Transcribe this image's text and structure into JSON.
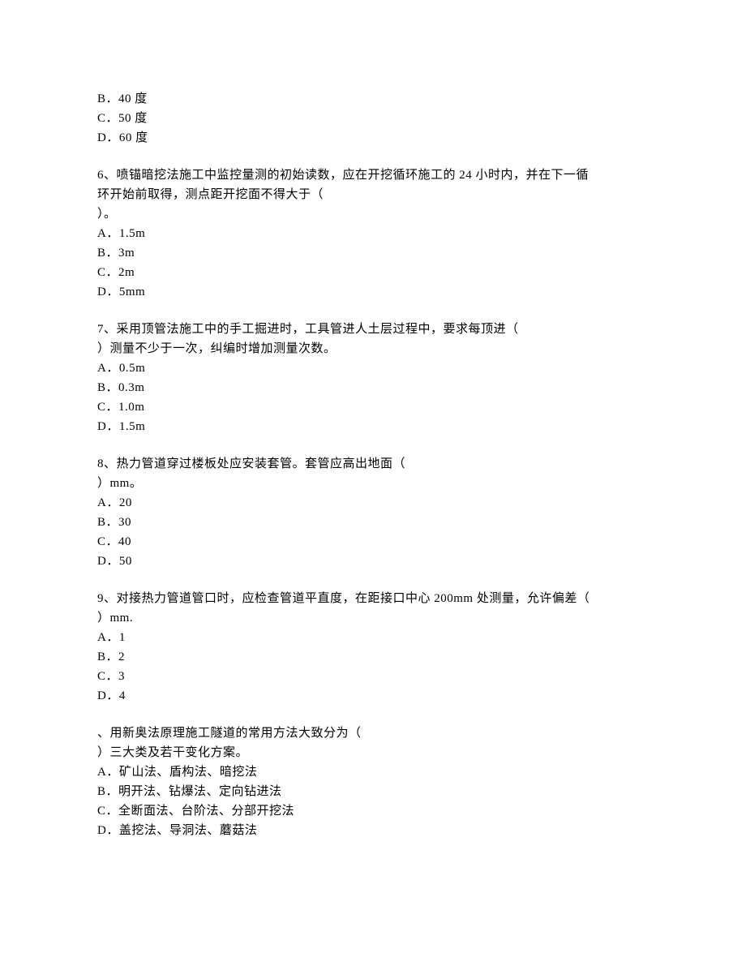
{
  "q5_partial": {
    "options": [
      "B．40 度",
      "C．50 度",
      "D．60 度"
    ]
  },
  "q6": {
    "stem_line1": "6、喷锚暗挖法施工中监控量测的初始读数，应在开挖循环施工的 24 小时内，并在下一循",
    "stem_line2": "环开始前取得，测点距开挖面不得大于（",
    "stem_line3": "）。",
    "options": [
      "A．1.5m",
      "B．3m",
      "C．2m",
      "D．5mm"
    ]
  },
  "q7": {
    "stem_line1": "7、采用顶管法施工中的手工掘进时，工具管进人土层过程中，要求每顶进（",
    "stem_line2": "）测量不少于一次，纠编时增加测量次数。",
    "options": [
      "A．0.5m",
      "B．0.3m",
      "C．1.0m",
      "D．1.5m"
    ]
  },
  "q8": {
    "stem_line1": "8、热力管道穿过楼板处应安装套管。套管应高出地面（",
    "stem_line2": "）mm。",
    "options": [
      "A．20",
      "B．30",
      "C．40",
      "D．50"
    ]
  },
  "q9": {
    "stem_line1": "9、对接热力管道管口时，应检查管道平直度，在距接口中心 200mm 处测量，允许偏差（",
    "stem_line2": "）mm.",
    "options": [
      "A．1",
      "B．2",
      "C．3",
      "D．4"
    ]
  },
  "q10": {
    "stem_line1": "、用新奥法原理施工隧道的常用方法大致分为（",
    "stem_line2": "）三大类及若干变化方案。",
    "options": [
      "A．矿山法、盾构法、暗挖法",
      "B．明开法、钻爆法、定向钻进法",
      "C．全断面法、台阶法、分部开挖法",
      "D．盖挖法、导洞法、蘑菇法"
    ]
  }
}
